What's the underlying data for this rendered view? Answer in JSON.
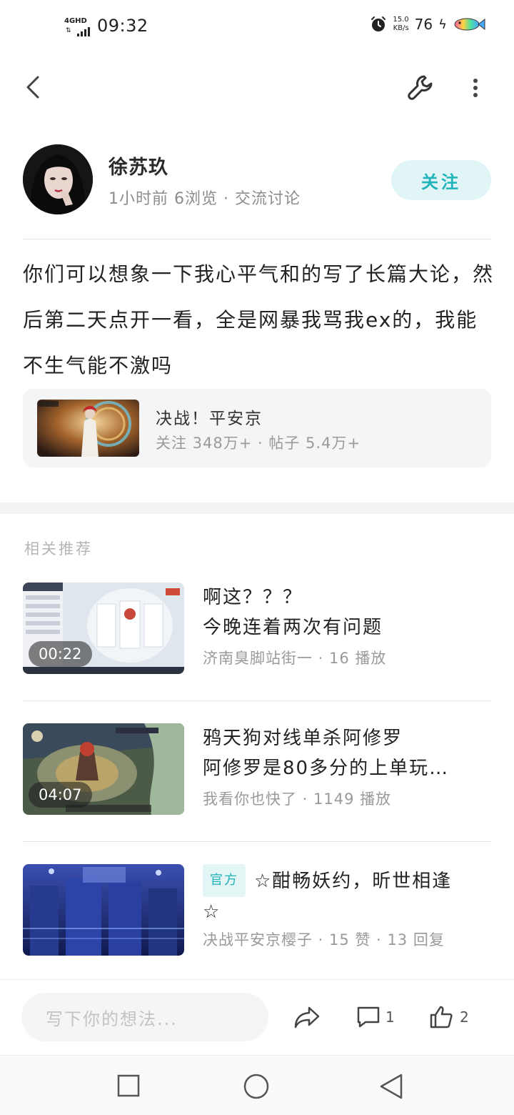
{
  "status_bar": {
    "network": "4GHD",
    "time": "09:32",
    "speed_value": "15.0",
    "speed_unit": "KB/s",
    "battery": "76"
  },
  "author": {
    "name": "徐苏玖",
    "meta": "1小时前 6浏览 · 交流讨论",
    "follow_label": "关注"
  },
  "post": {
    "text": "你们可以想象一下我心平气和的写了长篇大论，然后第二天点开一看，全是网暴我骂我ex的，我能不生气能不激吗"
  },
  "game_card": {
    "title": "决战！平安京",
    "stats": "关注 348万+ · 帖子 5.4万+"
  },
  "related": {
    "title": "相关推荐",
    "items": [
      {
        "line1": "啊这？？？",
        "line2": "今晚连着两次有问题",
        "duration": "00:22",
        "meta": "济南臭脚站街一 · 16 播放"
      },
      {
        "line1": "鸦天狗对线单杀阿修罗",
        "line2": "阿修罗是80多分的上单玩…",
        "duration": "04:07",
        "meta": "我看你也快了 · 1149 播放"
      },
      {
        "tag": "官方",
        "line1": "☆酣畅妖约，昕世相逢",
        "line2": "☆",
        "meta": "决战平安京樱子 · 15 赞 · 13 回复"
      }
    ]
  },
  "bottom_bar": {
    "placeholder": "写下你的想法...",
    "comment_count": "1",
    "like_count": "2"
  },
  "colors": {
    "accent": "#1fb5bb",
    "accent_bg": "#e2f5f6",
    "secondary_text": "#9a9a9a"
  }
}
